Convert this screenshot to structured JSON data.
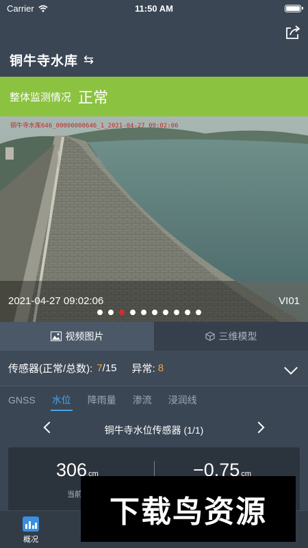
{
  "status_bar": {
    "carrier": "Carrier",
    "time": "11:50 AM"
  },
  "header": {
    "title": "铜牛寺水库",
    "swap_icon": "⇆"
  },
  "banner": {
    "label": "整体监测情况",
    "value": "正常",
    "color": "#8bc240"
  },
  "video": {
    "overlay": "铜牛寺水库646_00000000646_1_2021-04-27 09:02:06",
    "date": "2021-04-27 09:02:06",
    "camera_id": "VI01",
    "page_count": 10,
    "active_index": 2
  },
  "media_tabs": [
    {
      "label": "视频图片",
      "icon": "image-icon",
      "active": true
    },
    {
      "label": "三维模型",
      "icon": "cube-icon",
      "active": false
    }
  ],
  "sensors": {
    "label": "传感器(正常/总数):",
    "normal": "7",
    "total": "/15",
    "abnormal_label": "异常:",
    "abnormal": "8"
  },
  "sensor_tabs": [
    "GNSS",
    "水位",
    "降雨量",
    "渗流",
    "浸润线"
  ],
  "sensor_nav": {
    "title": "铜牛寺水位传感器 (1/1)"
  },
  "metrics": {
    "left": {
      "value": "306",
      "unit": "cm",
      "label": "当前"
    },
    "right": {
      "value": "−0.75",
      "unit": "cm",
      "label": ""
    }
  },
  "bottom_nav": [
    {
      "label": "概况",
      "icon": "bar-chart-icon",
      "active": true
    }
  ],
  "watermark": "下载鸟资源",
  "colors": {
    "accent": "#4aa4e6",
    "orange": "#f2a33a",
    "alert_dot": "#d42b2b"
  }
}
